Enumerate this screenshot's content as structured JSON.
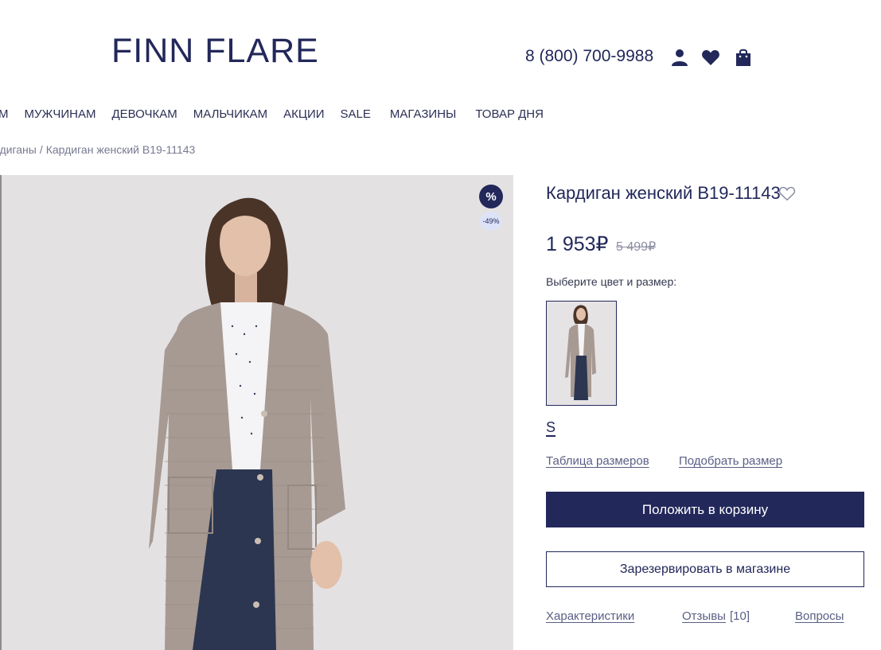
{
  "header": {
    "logo": "FINN FLARE",
    "phone": "8 (800) 700-9988",
    "icons": [
      "user-icon",
      "heart-icon",
      "shopping-bag-icon"
    ]
  },
  "nav": {
    "items": [
      "АМ",
      "МУЖЧИНАМ",
      "ДЕВОЧКАМ",
      "МАЛЬЧИКАМ",
      "АКЦИИ",
      "SALE",
      "МАГАЗИНЫ",
      "ТОВАР ДНЯ"
    ]
  },
  "breadcrumb": {
    "parent": "рдиганы",
    "separator": "/",
    "current": "Кардиган женский B19-11143"
  },
  "product": {
    "badge_symbol": "%",
    "discount": "-49%",
    "title": "Кардиган женский B19-11143",
    "price": "1 953₽",
    "old_price": "5 499₽",
    "choose_label": "Выберите цвет и размер:",
    "size": "S",
    "size_table_link": "Таблица размеров",
    "find_size_link": "Подобрать размер",
    "add_to_cart": "Положить в корзину",
    "reserve": "Зарезервировать в магазине"
  },
  "tabs": {
    "characteristics": "Характеристики",
    "reviews": "Отзывы",
    "reviews_count": "[10]",
    "questions": "Вопросы"
  },
  "colors": {
    "brand": "#22285a",
    "photo_bg": "#e4e1e3"
  }
}
